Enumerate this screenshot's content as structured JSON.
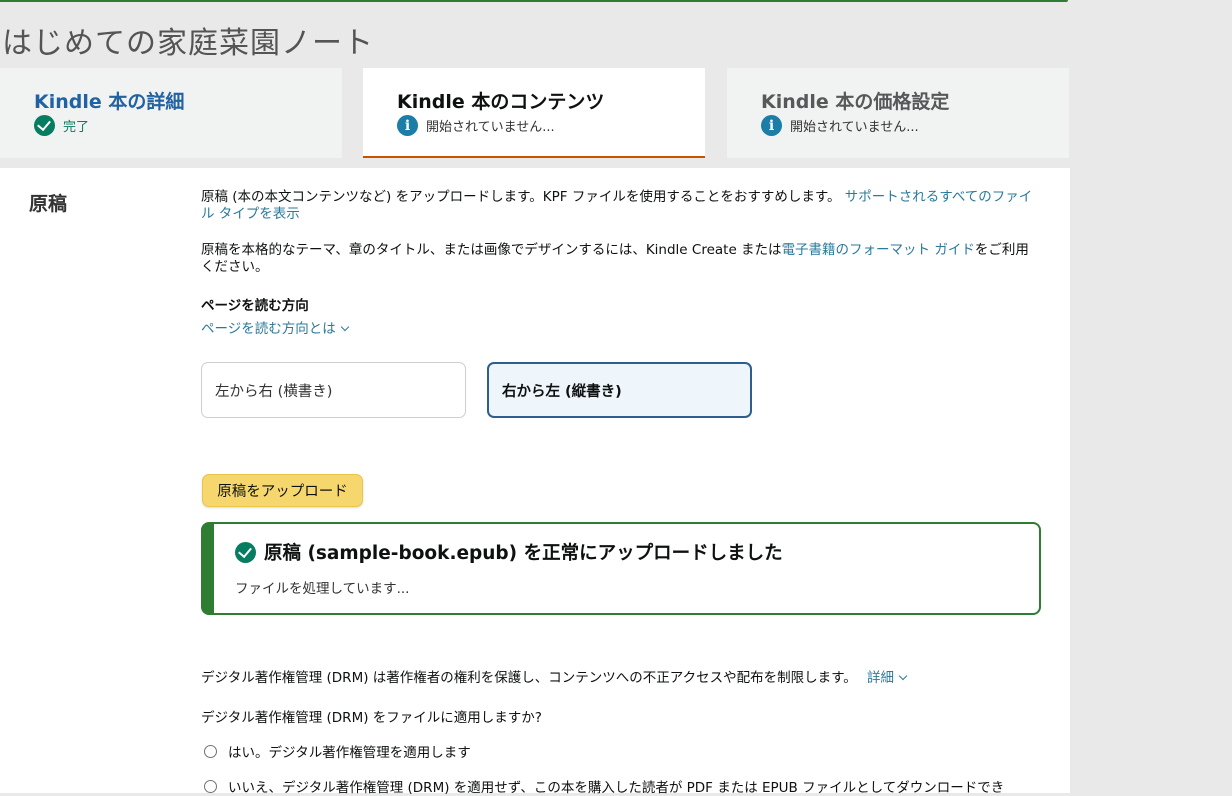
{
  "book_title": "はじめての家庭菜園ノート",
  "tabs": [
    {
      "title": "Kindle 本の詳細",
      "status": "完了",
      "status_icon": "check-circle-icon"
    },
    {
      "title": "Kindle 本のコンテンツ",
      "status": "開始されていません...",
      "status_icon": "info-icon"
    },
    {
      "title": "Kindle 本の価格設定",
      "status": "開始されていません...",
      "status_icon": "info-icon"
    }
  ],
  "manuscript": {
    "label": "原稿",
    "intro_text": "原稿 (本の本文コンテンツなど) をアップロードします。KPF ファイルを使用することをおすすめします。",
    "intro_link": "サポートされるすべてのファイル タイプを表示",
    "design_text_before": "原稿を本格的なテーマ、章のタイトル、または画像でデザインするには、Kindle Create または",
    "design_link": "電子書籍のフォーマット ガイド",
    "design_text_after": "をご利用ください。",
    "direction_heading": "ページを読む方向",
    "direction_help": "ページを読む方向とは",
    "direction_options": [
      "左から右 (横書き)",
      "右から左 (縦書き)"
    ],
    "direction_selected": "右から左 (縦書き)",
    "upload_button": "原稿をアップロード",
    "success_title": "原稿 (sample-book.epub) を正常にアップロードしました",
    "success_sub": "ファイルを処理しています..."
  },
  "drm": {
    "description": "デジタル著作権管理 (DRM) は著作権者の権利を保護し、コンテンツへの不正アクセスや配布を制限します。",
    "details_link": "詳細",
    "question": "デジタル著作権管理 (DRM) をファイルに適用しますか?",
    "options": [
      "はい。デジタル著作権管理を適用します",
      "いいえ、デジタル著作権管理 (DRM) を適用せず、この本を購入した読者が PDF または EPUB ファイルとしてダウンロードでき"
    ]
  },
  "colors": {
    "accent_green": "#2e7d32",
    "link_blue": "#2a7a9a",
    "tab_active_underline": "#c45500",
    "upload_button_yellow": "#f5d76e",
    "selected_border": "#2c5f8f"
  }
}
